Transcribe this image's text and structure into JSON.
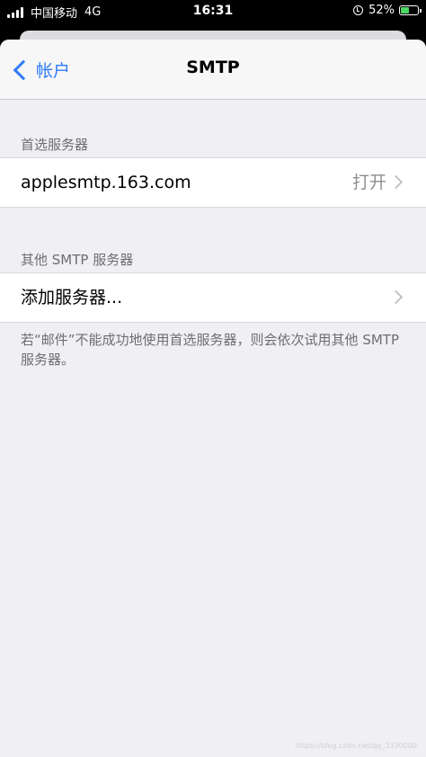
{
  "status_bar": {
    "carrier": "中国移动",
    "network": "4G",
    "time": "16:31",
    "battery_percent": "52%",
    "battery_level": 0.52,
    "icons": [
      "signal-icon",
      "alarm-icon",
      "battery-icon"
    ]
  },
  "nav": {
    "back_label": "帐户",
    "title": "SMTP"
  },
  "primary_server": {
    "header": "首选服务器",
    "server": "applesmtp.163.com",
    "status": "打开"
  },
  "other_servers": {
    "header": "其他 SMTP 服务器",
    "add_label": "添加服务器..."
  },
  "footer_note": "若“邮件”不能成功地使用首选服务器，则会依次试用其他 SMTP 服务器。",
  "watermark": "https://blog.csdn.net/qq_3330000",
  "colors": {
    "accent": "#2f7cf6",
    "background": "#efeff4",
    "secondary_text": "#6d6d72"
  }
}
